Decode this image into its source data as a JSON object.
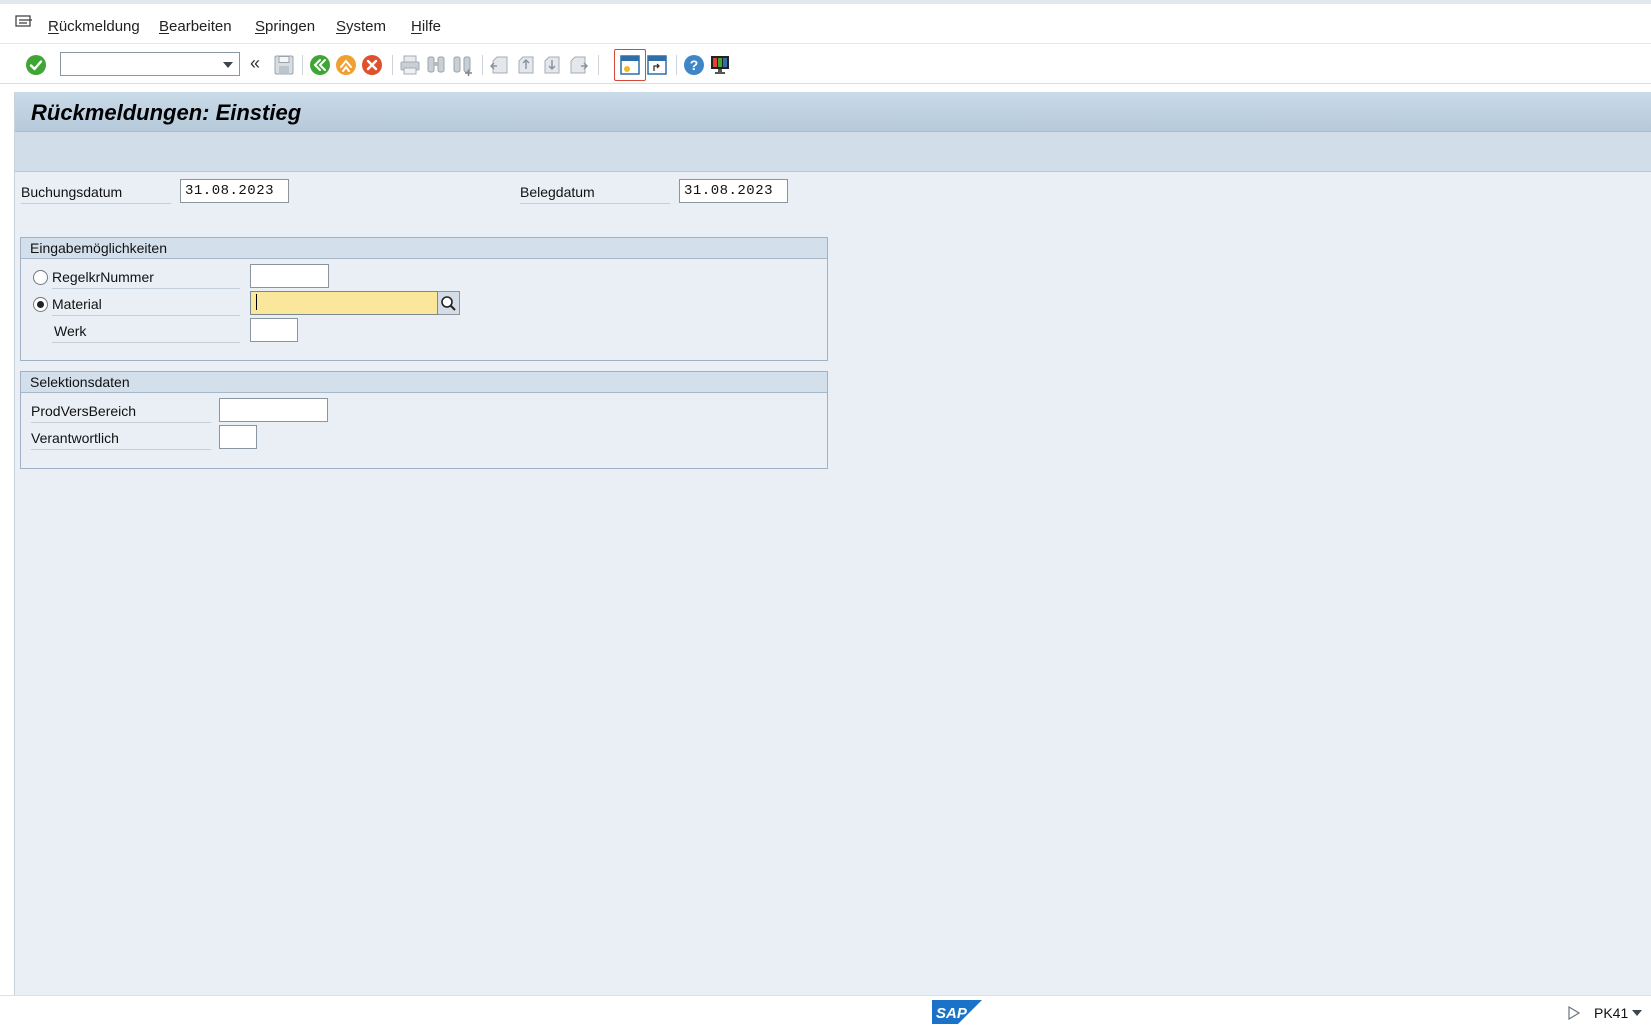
{
  "menu": {
    "items": [
      {
        "accel": "R",
        "rest": "ückmeldung"
      },
      {
        "accel": "B",
        "rest": "earbeiten"
      },
      {
        "accel": "S",
        "rest": "pringen"
      },
      {
        "accel": "S",
        "rest": "ystem"
      },
      {
        "accel": "H",
        "rest": "ilfe"
      }
    ]
  },
  "toolbar": {
    "command_value": "",
    "icons": [
      "enter-icon",
      "save-icon",
      "back-icon",
      "exit-icon",
      "cancel-icon",
      "print-icon",
      "find-icon",
      "find-next-icon",
      "first-page-icon",
      "previous-page-icon",
      "next-page-icon",
      "last-page-icon",
      "create-session-icon",
      "shortcut-icon",
      "help-icon",
      "layout-menu-icon"
    ],
    "double_chevron": "«"
  },
  "screen": {
    "title": "Rückmeldungen: Einstieg"
  },
  "header_fields": {
    "posting_date_label": "Buchungsdatum",
    "posting_date_value": "31.08.2023",
    "document_date_label": "Belegdatum",
    "document_date_value": "31.08.2023"
  },
  "input_options": {
    "title": "Eingabemöglichkeiten",
    "control_cycle_label": "RegelkrNummer",
    "control_cycle_value": "",
    "material_label": "Material",
    "material_value": "",
    "plant_label": "Werk",
    "plant_value": "",
    "selected": "material"
  },
  "selection_data": {
    "title": "Selektionsdaten",
    "supply_area_label": "ProdVersBereich",
    "supply_area_value": "",
    "responsible_label": "Verantwortlich",
    "responsible_value": ""
  },
  "statusbar": {
    "logo_text": "SAP",
    "tcode": "PK41"
  },
  "colors": {
    "accent_green": "#3fa535",
    "accent_orange": "#f0a030",
    "accent_red": "#e0502c",
    "focus_yellow": "#fbe79c",
    "sap_blue": "#1a73c8"
  }
}
